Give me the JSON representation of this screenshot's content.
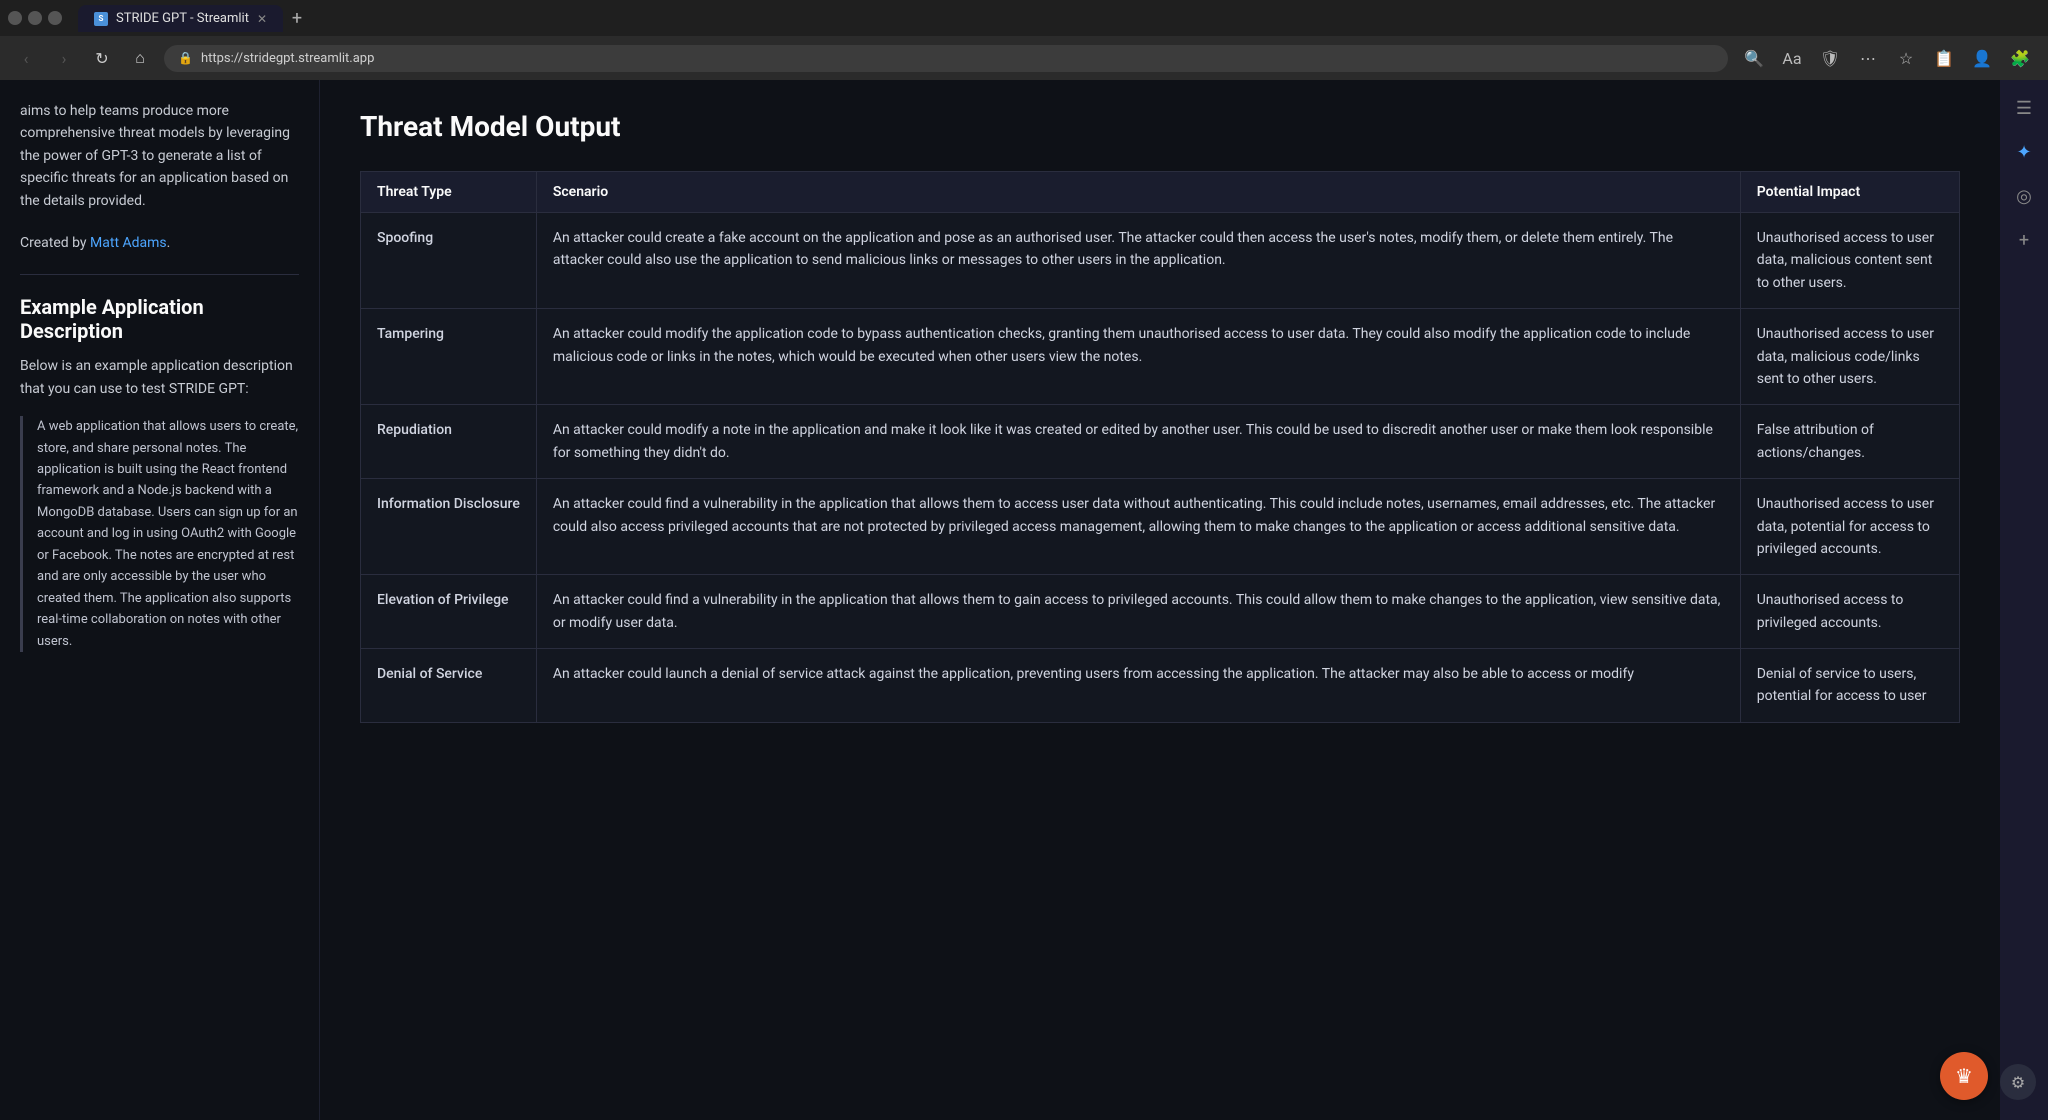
{
  "browser": {
    "title": "STRIDE GPT - Streamlit",
    "url": "https://stridegpt.streamlit.app",
    "tab_label": "STRIDE GPT - Streamlit"
  },
  "sidebar": {
    "intro_text": "aims to help teams produce more comprehensive threat models by leveraging the power of GPT-3 to generate a list of specific threats for an application based on the details provided.",
    "created_by_prefix": "Created by ",
    "author_name": "Matt Adams",
    "author_link": "#",
    "divider": true,
    "section_title": "Example Application Description",
    "section_desc": "Below is an example application description that you can use to test STRIDE GPT:",
    "blockquote": "A web application that allows users to create, store, and share personal notes. The application is built using the React frontend framework and a Node.js backend with a MongoDB database. Users can sign up for an account and log in using OAuth2 with Google or Facebook. The notes are encrypted at rest and are only accessible by the user who created them. The application also supports real-time collaboration on notes with other users."
  },
  "main": {
    "page_title": "Threat Model Output",
    "table": {
      "headers": [
        "Threat Type",
        "Scenario",
        "Potential Impact"
      ],
      "rows": [
        {
          "threat_type": "Spoofing",
          "scenario": "An attacker could create a fake account on the application and pose as an authorised user. The attacker could then access the user's notes, modify them, or delete them entirely. The attacker could also use the application to send malicious links or messages to other users in the application.",
          "impact": "Unauthorised access to user data, malicious content sent to other users."
        },
        {
          "threat_type": "Tampering",
          "scenario": "An attacker could modify the application code to bypass authentication checks, granting them unauthorised access to user data. They could also modify the application code to include malicious code or links in the notes, which would be executed when other users view the notes.",
          "impact": "Unauthorised access to user data, malicious code/links sent to other users."
        },
        {
          "threat_type": "Repudiation",
          "scenario": "An attacker could modify a note in the application and make it look like it was created or edited by another user. This could be used to discredit another user or make them look responsible for something they didn't do.",
          "impact": "False attribution of actions/changes."
        },
        {
          "threat_type": "Information Disclosure",
          "scenario": "An attacker could find a vulnerability in the application that allows them to access user data without authenticating. This could include notes, usernames, email addresses, etc. The attacker could also access privileged accounts that are not protected by privileged access management, allowing them to make changes to the application or access additional sensitive data.",
          "impact": "Unauthorised access to user data, potential for access to privileged accounts."
        },
        {
          "threat_type": "Elevation of Privilege",
          "scenario": "An attacker could find a vulnerability in the application that allows them to gain access to privileged accounts. This could allow them to make changes to the application, view sensitive data, or modify user data.",
          "impact": "Unauthorised access to privileged accounts."
        },
        {
          "threat_type": "Denial of Service",
          "scenario": "An attacker could launch a denial of service attack against the application, preventing users from accessing the application. The attacker may also be able to access or modify",
          "impact": "Denial of service to users, potential for access to user"
        }
      ]
    }
  },
  "icons": {
    "back": "‹",
    "forward": "›",
    "reload": "↻",
    "home": "⌂",
    "lock": "🔒",
    "search": "🔍",
    "star": "☆",
    "menu": "⋯",
    "extensions": "🧩",
    "close": "✕",
    "new_tab": "+",
    "hamburger": "☰",
    "settings": "⚙",
    "crown": "♛"
  }
}
